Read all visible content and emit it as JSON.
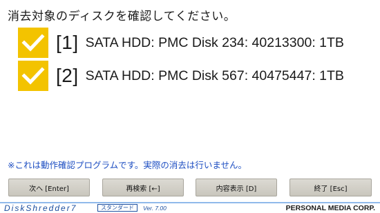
{
  "header": {
    "title": "消去対象のディスクを確認してください。"
  },
  "disks": [
    {
      "index": "[1]",
      "label": "SATA HDD: PMC Disk 234: 40213300: 1TB",
      "checked": true
    },
    {
      "index": "[2]",
      "label": "SATA HDD: PMC Disk 567: 40475447: 1TB",
      "checked": true
    }
  ],
  "notice": "※これは動作確認プログラムです。実際の消去は行いません。",
  "buttons": {
    "next": "次へ [Enter]",
    "rescan": "再検索 [←]",
    "details": "内容表示 [D]",
    "quit": "終了 [Esc]"
  },
  "footer": {
    "brand": "DiskShredder7",
    "edition": "スタンダード",
    "version": "Ver. 7.00",
    "company": "PERSONAL MEDIA CORP."
  },
  "colors": {
    "checkbox": "#f3c300",
    "notice": "#1d4ec2",
    "brand": "#1c4fa0"
  },
  "icons": {
    "checkbox": "checkmark-icon"
  }
}
